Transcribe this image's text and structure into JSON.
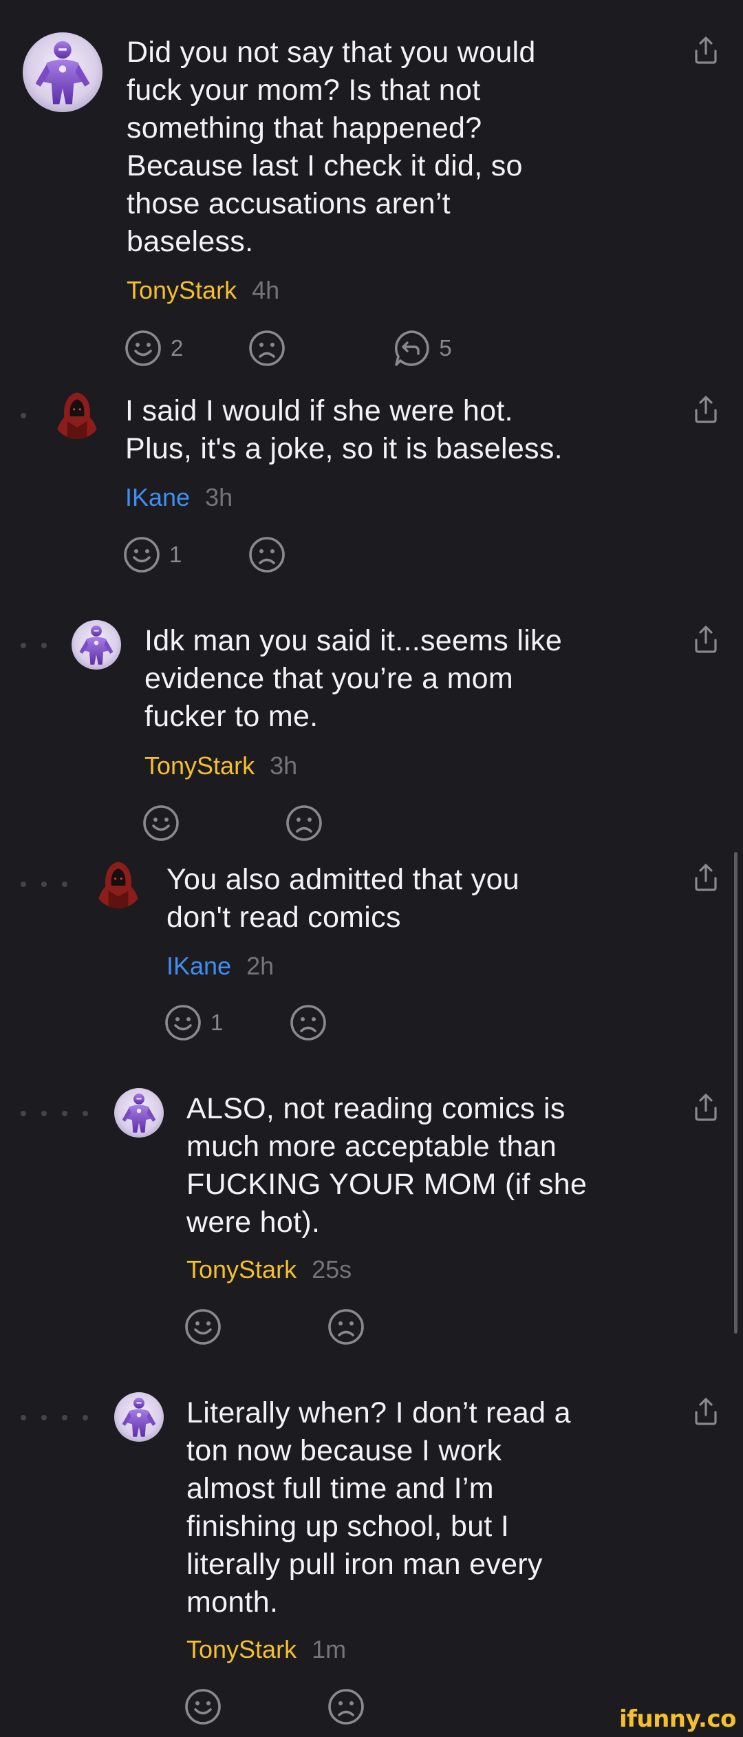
{
  "comments": [
    {
      "text": "Did you not say that you would\nfuck your mom? Is that not\nsomething that happened?\nBecause last I check it did, so\nthose accusations aren’t\nbaseless.",
      "author": "TonyStark",
      "time": "4h",
      "smile_count": "2",
      "replies_count": "5",
      "avatar": "iron-man-avatar"
    },
    {
      "text": "I said I would if she were hot.\nPlus, it's a joke, so it is baseless.",
      "author": "IKane",
      "time": "3h",
      "smile_count": "1",
      "avatar": "hooded-figure-avatar"
    },
    {
      "text": "Idk man you said it...seems like\nevidence that you’re a mom\nfucker to me.",
      "author": "TonyStark",
      "time": "3h",
      "avatar": "iron-man-avatar"
    },
    {
      "text": "You also admitted that you\ndon't read comics",
      "author": "IKane",
      "time": "2h",
      "smile_count": "1",
      "avatar": "hooded-figure-avatar"
    },
    {
      "text": "ALSO, not reading comics is\nmuch more acceptable than\nFUCKING YOUR MOM (if she\nwere hot).",
      "author": "TonyStark",
      "time": "25s",
      "avatar": "iron-man-avatar"
    },
    {
      "text": "Literally when? I don’t read a\nton now because I work\nalmost full time and I’m\nfinishing up school, but I\nliterally pull iron man every\nmonth.",
      "author": "TonyStark",
      "time": "1m",
      "avatar": "iron-man-avatar"
    }
  ],
  "watermark": "ifunny.co",
  "colors": {
    "background": "#1c1b20",
    "tony_author": "#f5c02a",
    "ikane_author": "#3f8ef2",
    "timestamp": "#75747b"
  }
}
